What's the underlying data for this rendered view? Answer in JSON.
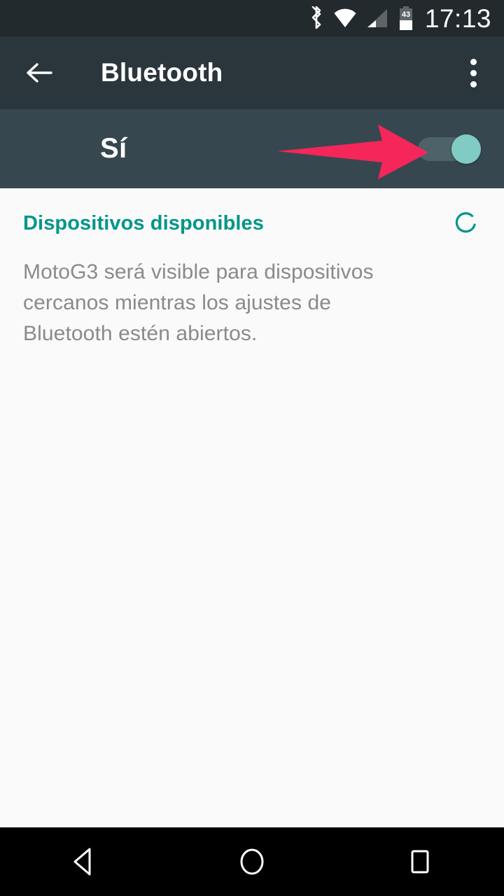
{
  "status_bar": {
    "time": "17:13",
    "battery_level": "43",
    "icons": [
      "bluetooth-icon",
      "wifi-icon",
      "cellular-signal-icon",
      "battery-icon"
    ],
    "background_color": "#232a2e"
  },
  "app_bar": {
    "title": "Bluetooth",
    "back_icon": "back-arrow-icon",
    "overflow_icon": "overflow-menu-icon",
    "background_color": "#2b363c"
  },
  "toggle_panel": {
    "state_label": "Sí",
    "switch_on": true,
    "switch_thumb_color": "#80cbc4",
    "switch_track_color": "#4d6269",
    "background_color": "#37474f"
  },
  "annotation": {
    "type": "arrow",
    "direction": "right",
    "color": "#f5265a",
    "points_to": "bluetooth-toggle-switch"
  },
  "content": {
    "section_title": "Dispositivos disponibles",
    "section_title_color": "#009688",
    "spinner_icon": "scanning-spinner-icon",
    "description": "MotoG3 será visible para dispositivos cercanos mientras los ajustes de Bluetooth estén abiertos.",
    "background_color": "#fafafa"
  },
  "nav_bar": {
    "back_icon": "nav-back-icon",
    "home_icon": "nav-home-icon",
    "recents_icon": "nav-recents-icon",
    "background_color": "#000000"
  }
}
